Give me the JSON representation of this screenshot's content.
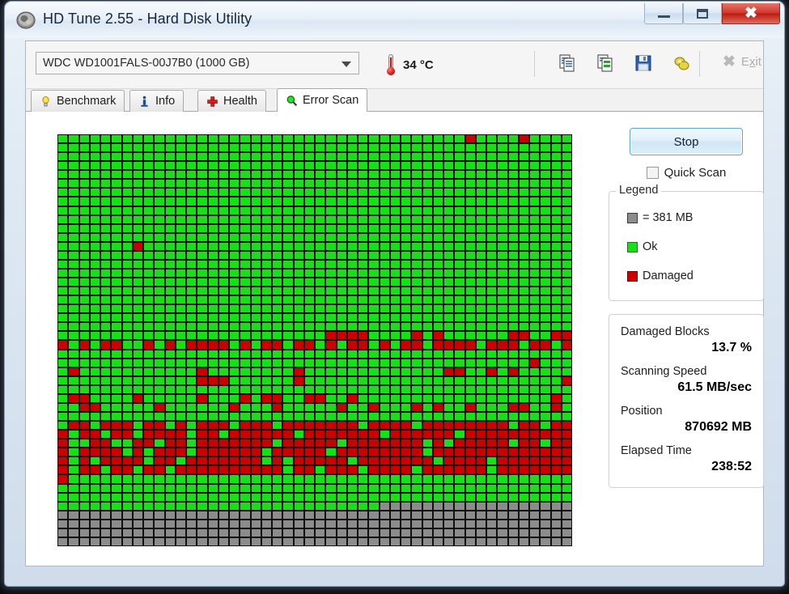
{
  "window": {
    "title": "HD Tune 2.55 - Hard Disk Utility",
    "app_icon": "hdtune-disk-icon",
    "minimize_label": "Minimize",
    "maximize_label": "Maximize",
    "close_label": "Close"
  },
  "toolbar": {
    "drive": "WDC WD1001FALS-00J7B0 (1000 GB)",
    "temperature": "34 °C",
    "thermometer_icon": "thermometer-icon",
    "icons": [
      {
        "name": "copy-icon",
        "title": "Copy"
      },
      {
        "name": "copy-screenshot-icon",
        "title": "Copy screenshot"
      },
      {
        "name": "save-icon",
        "title": "Save"
      },
      {
        "name": "options-icon",
        "title": "Options"
      }
    ],
    "exit_label": "Exit",
    "exit_icon": "close-x-icon"
  },
  "tabs": [
    {
      "label": "Benchmark",
      "icon": "lightbulb-icon",
      "active": false
    },
    {
      "label": "Info",
      "icon": "info-icon",
      "active": false
    },
    {
      "label": "Health",
      "icon": "red-cross-icon",
      "active": false
    },
    {
      "label": "Error Scan",
      "icon": "magnifier-icon",
      "active": true
    }
  ],
  "controls": {
    "stop_label": "Stop",
    "quick_scan_label": "Quick Scan",
    "quick_scan_checked": false
  },
  "legend": {
    "title": "Legend",
    "block_size": "= 381 MB",
    "ok_label": "Ok",
    "damaged_label": "Damaged",
    "colors": {
      "ok": "#17e017",
      "damaged": "#cc0000",
      "unscanned": "#8c8c8c",
      "grid": "#111111"
    }
  },
  "stats": [
    {
      "label": "Damaged Blocks",
      "value": "13.7 %"
    },
    {
      "label": "Scanning Speed",
      "value": "61.5 MB/sec"
    },
    {
      "label": "Position",
      "value": "870692 MB"
    },
    {
      "label": "Elapsed Time",
      "value": "238:52"
    }
  ],
  "chart_data": {
    "type": "heatmap",
    "title": "Error Scan block map",
    "cols": 48,
    "rows": 38,
    "block_size_mb": 381,
    "legend": {
      "0": "Ok",
      "1": "Damaged",
      "2": "Unscanned"
    },
    "palette": {
      "0": "#17e017",
      "1": "#cc0000",
      "2": "#8c8c8c"
    },
    "scan_progress_pct": 85.5,
    "damaged_pct": 13.7,
    "rows_data": [
      "000000000000000000000000000000000000001000010000",
      "000000000000000000000000000000000000000000000000",
      "000000000000000000000000000000000000000000000000",
      "000000000000000000000000000000000000000000000000",
      "000000000000000000000000000000000000000000000000",
      "000000000000000000000000000000000000000000000000",
      "000000000000000000000000000000000000000000000000",
      "000000000000000000000000000000000000000000000000",
      "000000000000000000000000000000000000000000000000",
      "000000000000000000000000000000000000000000000000",
      "000000000000000000000000000000000000000000000000",
      "000000000000000000000000000000000000000000000000",
      "000000010000000000000000000000000000000000000000",
      "000000000000000000000000000000000000000000000000",
      "000000000000000000000000000000000000000000000000",
      "000000000000000000000000000000000000000000000000",
      "000000000000000000000000000000000000000000000000",
      "000000000000000000000000000000000000000000000000",
      "000000000000000000000000000000000000000000000000",
      "000000000000000000000000000000000000000000000000",
      "000000000000000000000000000000000000000000000000",
      "000000000000000000000000000000000000000000000000",
      "000000000000000000000000011110000101000000110011",
      "101011001010111101011011010110101101111011101101",
      "000000000000000000000000000000000000000000000000",
      "000000000000000000000000000000000000000000001000",
      "010000000000010000000010000000000000110010100000",
      "000000000000011100000010000000000000000000000001",
      "000000000000000000000000000000000000000000000000",
      "011000010000010001011001100100000000000000000010",
      "001100000100000010001000001001000101001000110010",
      "000000000000000000000000000000000000000000000000",
      "011011101101011101110111111101111011111111011011",
      "101101101111011011111101111111011111101111111111",
      "100110011011011111110111110111111101011111011011",
      "101111010111011111101111101111111101111111111111",
      "101011110110111111101011111011111110111101111111",
      "101101101101111111111011011101111011111101111111",
      "100000000000000000000000000000000000000000000000",
      "000000000000000000000000000000000000000000000000",
      "000000000000000000000000000000000000000000000000",
      "000000000000000000000000000000222222222222222222",
      "222222222222222222222222222222222222222222222222",
      "222222222222222222222222222222222222222222222222",
      "222222222222222222222222222222222222222222222222",
      "222222222222222222222222222222222222222222222222"
    ]
  }
}
